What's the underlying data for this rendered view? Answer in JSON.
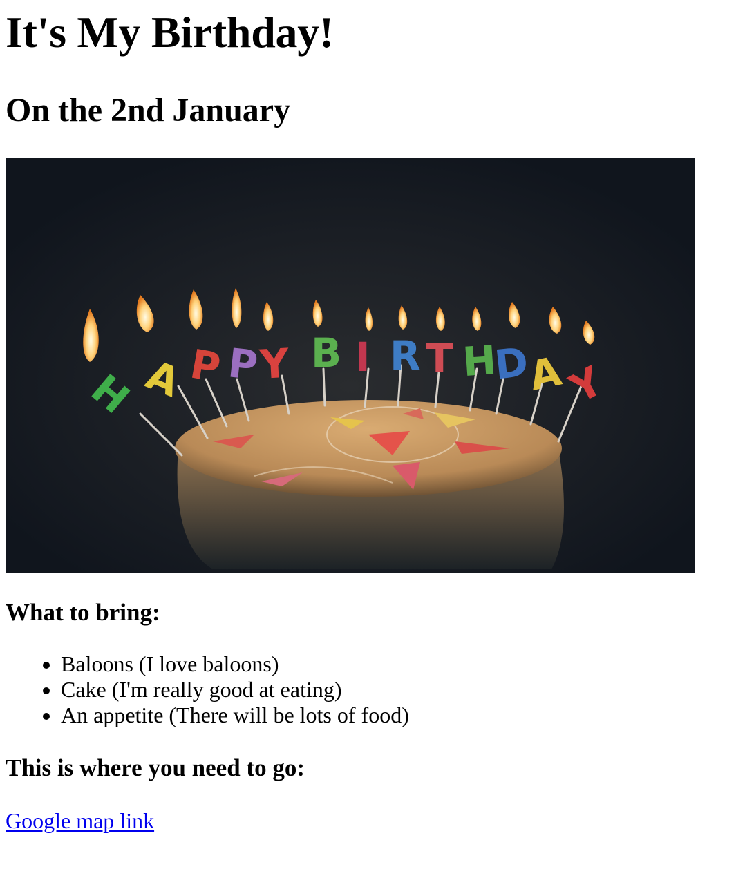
{
  "heading": "It's My Birthday!",
  "subheading": "On the 2nd January",
  "hero_image": {
    "alt": "Birthday cake with HAPPY BIRTHDAY letter candles",
    "candle_letters": [
      "H",
      "A",
      "P",
      "P",
      "Y",
      "B",
      "I",
      "R",
      "T",
      "H",
      "D",
      "A",
      "Y"
    ],
    "colors": {
      "background": "#121821",
      "cake": "#c89a63",
      "candles": [
        "#3fae4a",
        "#e3c93a",
        "#d6443a",
        "#9b6fc0",
        "#d9423f",
        "#5bb04f",
        "#c2374f",
        "#3e7cc4",
        "#cf4c54",
        "#55a94b",
        "#3a6fbf",
        "#e0bf3b",
        "#d33b3b"
      ]
    }
  },
  "bring": {
    "heading": "What to bring:",
    "items": [
      "Baloons (I love baloons)",
      "Cake (I'm really good at eating)",
      "An appetite (There will be lots of food)"
    ]
  },
  "directions": {
    "heading": "This is where you need to go:",
    "link_text": "Google map link"
  }
}
